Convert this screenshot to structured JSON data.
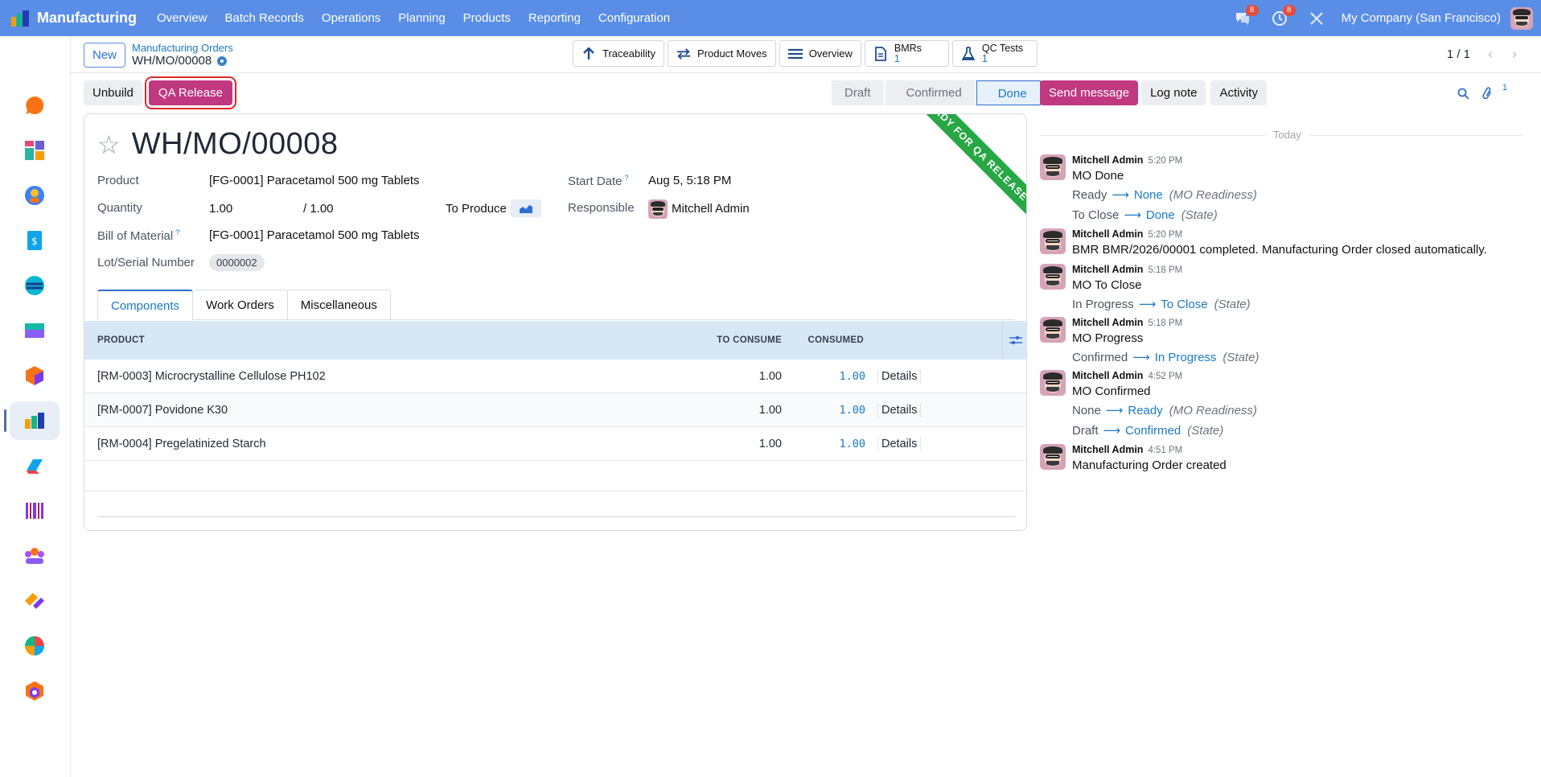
{
  "navbar": {
    "app_name": "Manufacturing",
    "menu": [
      "Overview",
      "Batch Records",
      "Operations",
      "Planning",
      "Products",
      "Reporting",
      "Configuration"
    ],
    "messages_count": "8",
    "activities_count": "8",
    "company": "My Company (San Francisco)"
  },
  "control": {
    "new_label": "New",
    "breadcrumb_parent": "Manufacturing Orders",
    "breadcrumb_current": "WH/MO/00008",
    "smart_buttons": {
      "traceability": "Traceability",
      "product_moves": "Product Moves",
      "overview": "Overview",
      "bmrs_label": "BMRs",
      "bmrs_value": "1",
      "qc_label": "QC Tests",
      "qc_value": "1"
    },
    "pager": "1 / 1"
  },
  "actions": {
    "unbuild": "Unbuild",
    "qa_release": "QA Release"
  },
  "statusbar": {
    "stages": [
      "Draft",
      "Confirmed",
      "Done"
    ],
    "active": "Done"
  },
  "form": {
    "ribbon": "READY FOR QA RELEASE",
    "title": "WH/MO/00008",
    "labels": {
      "product": "Product",
      "quantity": "Quantity",
      "bom": "Bill of Material",
      "lot": "Lot/Serial Number",
      "start_date": "Start Date",
      "responsible": "Responsible",
      "help_mark": "?"
    },
    "values": {
      "product": "[FG-0001] Paracetamol 500 mg Tablets",
      "quantity": "1.00",
      "quantity_total": "/ 1.00",
      "to_produce": "To Produce",
      "bom": "[FG-0001] Paracetamol 500 mg Tablets",
      "lot": "0000002",
      "start_date": "Aug 5, 5:18 PM",
      "responsible": "Mitchell Admin"
    },
    "tabs": [
      "Components",
      "Work Orders",
      "Miscellaneous"
    ],
    "table": {
      "headers": {
        "product": "PRODUCT",
        "to_consume": "TO CONSUME",
        "consumed": "CONSUMED"
      },
      "rows": [
        {
          "product": "[RM-0003] Microcrystalline Cellulose PH102",
          "to_consume": "1.00",
          "consumed": "1.00",
          "details": "Details"
        },
        {
          "product": "[RM-0007] Povidone K30",
          "to_consume": "1.00",
          "consumed": "1.00",
          "details": "Details"
        },
        {
          "product": "[RM-0004] Pregelatinized Starch",
          "to_consume": "1.00",
          "consumed": "1.00",
          "details": "Details"
        }
      ]
    }
  },
  "chatter": {
    "send_message": "Send message",
    "log_note": "Log note",
    "activity": "Activity",
    "attachments_count": "1",
    "today": "Today",
    "messages": [
      {
        "author": "Mitchell Admin",
        "time": "5:20 PM",
        "text": "MO Done",
        "tracking": [
          {
            "old": "Ready",
            "new": "None",
            "field": "(MO Readiness)"
          },
          {
            "old": "To Close",
            "new": "Done",
            "field": "(State)"
          }
        ]
      },
      {
        "author": "Mitchell Admin",
        "time": "5:20 PM",
        "text": "BMR BMR/2026/00001 completed. Manufacturing Order closed automatically.",
        "tracking": []
      },
      {
        "author": "Mitchell Admin",
        "time": "5:18 PM",
        "text": "MO To Close",
        "tracking": [
          {
            "old": "In Progress",
            "new": "To Close",
            "field": "(State)"
          }
        ]
      },
      {
        "author": "Mitchell Admin",
        "time": "5:18 PM",
        "text": "MO Progress",
        "tracking": [
          {
            "old": "Confirmed",
            "new": "In Progress",
            "field": "(State)"
          }
        ]
      },
      {
        "author": "Mitchell Admin",
        "time": "4:52 PM",
        "text": "MO Confirmed",
        "tracking": [
          {
            "old": "None",
            "new": "Ready",
            "field": "(MO Readiness)"
          },
          {
            "old": "Draft",
            "new": "Confirmed",
            "field": "(State)"
          }
        ]
      },
      {
        "author": "Mitchell Admin",
        "time": "4:51 PM",
        "text": "Manufacturing Order created",
        "tracking": []
      }
    ]
  },
  "colors": {
    "navbar": "#5a8ee6",
    "primary_action": "#c0387f",
    "link": "#1b79c2",
    "ribbon": "#28a745",
    "highlight_outline": "#e02828"
  }
}
